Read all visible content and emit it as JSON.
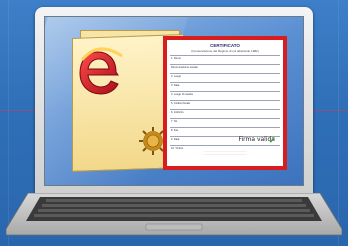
{
  "certificate": {
    "title": "CERTIFICATO",
    "subtitle": "(Conservazione del Regime di cui all'articolo 1982)",
    "signature_text": "Firma valida",
    "fields": [
      {
        "label": "1. Nome",
        "value": ""
      },
      {
        "label": "Denominazione sociale",
        "value": ""
      },
      {
        "label": "2. Luogo",
        "value": ""
      },
      {
        "label": "3. Data",
        "value": ""
      },
      {
        "label": "4. Luogo di nascita",
        "value": ""
      },
      {
        "label": "5. Codice fiscale",
        "value": ""
      },
      {
        "label": "6. Indirizzo",
        "value": ""
      },
      {
        "label": "7. Tel",
        "value": ""
      },
      {
        "label": "8. Fax",
        "value": ""
      },
      {
        "label": "9. Data",
        "value": ""
      },
      {
        "label": "10. Timbro",
        "value": ""
      }
    ]
  },
  "colors": {
    "background": "#3373bf",
    "certificate_border": "#d71d1d",
    "logo_red": "#d91e2a",
    "seal_gold": "#c98a18"
  },
  "icons": [
    "e-logo-icon",
    "seal-icon",
    "checkmark-icon",
    "laptop-icon"
  ]
}
